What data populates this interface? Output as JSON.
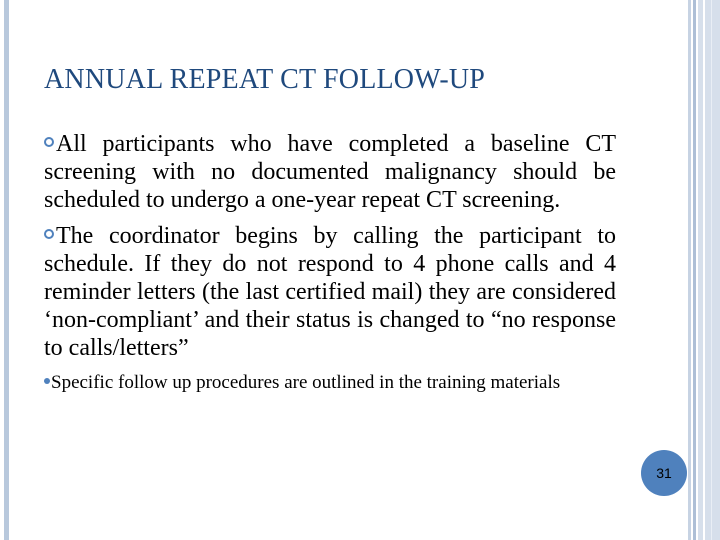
{
  "slide": {
    "title": "ANNUAL REPEAT CT FOLLOW-UP",
    "bullets": [
      {
        "level": 1,
        "icon": "ring-bullet-icon",
        "text": "All participants who have completed a baseline CT screening with no documented malignancy should be scheduled to undergo a one-year repeat CT screening."
      },
      {
        "level": 1,
        "icon": "ring-bullet-icon",
        "text": "The coordinator begins by calling the participant to schedule.  If they do not respond to 4 phone calls and 4 reminder letters (the last certified mail) they are considered ‘non-compliant’ and their status is changed to “no response to calls/letters”"
      },
      {
        "level": 2,
        "icon": "dot-bullet-icon",
        "text": "Specific follow up procedures are outlined in the training materials"
      }
    ],
    "page_number": "31"
  },
  "colors": {
    "title": "#1f497d",
    "accent": "#4f81bd",
    "stripe": "#b8c8dc"
  }
}
